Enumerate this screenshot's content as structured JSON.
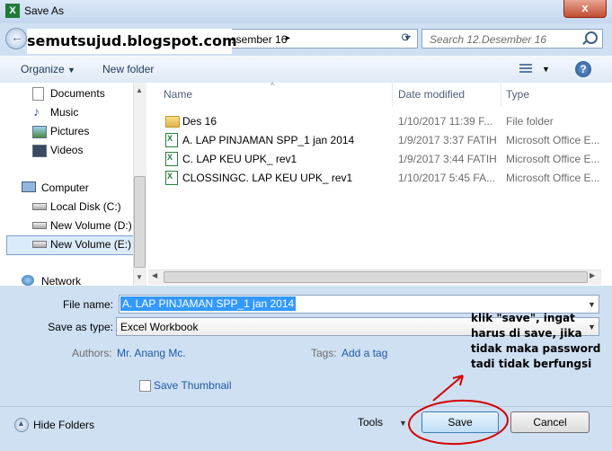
{
  "window": {
    "title": "Save As",
    "close_label": "x",
    "app_icon_label": "X"
  },
  "address_bar": {
    "path_text": "esember 16",
    "arrow": "▸"
  },
  "search": {
    "placeholder": "Search 12.Desember 16"
  },
  "watermark": {
    "text": "semutsujud.blogspot.com"
  },
  "toolbar": {
    "organize_label": "Organize",
    "new_folder_label": "New folder"
  },
  "nav": {
    "items": [
      {
        "label": "Documents",
        "icon": "documents-icon"
      },
      {
        "label": "Music",
        "icon": "music-icon"
      },
      {
        "label": "Pictures",
        "icon": "pictures-icon"
      },
      {
        "label": "Videos",
        "icon": "videos-icon"
      },
      {
        "label": "Computer",
        "icon": "computer-icon"
      },
      {
        "label": "Local Disk (C:)",
        "icon": "drive-icon"
      },
      {
        "label": "New Volume (D:)",
        "icon": "drive-icon"
      },
      {
        "label": "New Volume (E:)",
        "icon": "drive-icon"
      },
      {
        "label": "Network",
        "icon": "network-icon"
      }
    ],
    "selected": "New Volume (E:)"
  },
  "columns": {
    "name": "Name",
    "date": "Date modified",
    "type": "Type"
  },
  "files": [
    {
      "name": "Des 16",
      "date": "1/10/2017 11:39 F...",
      "type": "File folder",
      "icon": "folder-icon"
    },
    {
      "name": "A. LAP PINJAMAN SPP_1 jan 2014",
      "date": "1/9/2017 3:37 FATIH",
      "type": "Microsoft Office E...",
      "icon": "excel-icon"
    },
    {
      "name": "C. LAP KEU  UPK_ rev1",
      "date": "1/9/2017 3:44 FATIH",
      "type": "Microsoft Office E...",
      "icon": "excel-icon"
    },
    {
      "name": "CLOSSINGC. LAP KEU  UPK_ rev1",
      "date": "1/10/2017 5:45 FA...",
      "type": "Microsoft Office E...",
      "icon": "excel-icon"
    }
  ],
  "form": {
    "file_name_label": "File name:",
    "file_name_value": "A. LAP PINJAMAN SPP_1 jan 2014",
    "save_as_type_label": "Save as type:",
    "save_as_type_value": "Excel Workbook",
    "authors_label": "Authors:",
    "authors_value": "Mr. Anang Mc.",
    "tags_label": "Tags:",
    "tags_value": "Add a tag",
    "thumbnail_label": "Save Thumbnail"
  },
  "footer": {
    "hide_folders_label": "Hide Folders",
    "tools_label": "Tools",
    "save_label": "Save",
    "cancel_label": "Cancel"
  },
  "annotation": {
    "lines": [
      "klik \"save\", ingat",
      "harus di save, jika",
      "tidak maka password",
      "tadi tidak berfungsi"
    ],
    "color": "#d40000"
  }
}
